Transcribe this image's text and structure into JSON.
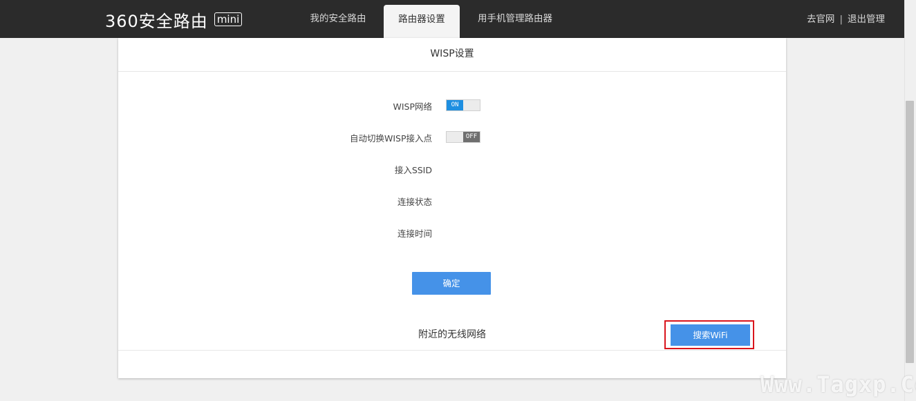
{
  "header": {
    "logo_text": "360安全路由",
    "logo_badge": "mini",
    "tabs": [
      {
        "label": "我的安全路由"
      },
      {
        "label": "路由器设置",
        "active": true
      },
      {
        "label": "用手机管理路由器"
      }
    ],
    "links": {
      "official_site": "去官网",
      "separator": "|",
      "logout": "退出管理"
    }
  },
  "wisp": {
    "title": "WISP设置",
    "rows": [
      {
        "label": "WISP网络",
        "toggle": "ON"
      },
      {
        "label": "自动切换WISP接入点",
        "toggle": "OFF"
      },
      {
        "label": "接入SSID"
      },
      {
        "label": "连接状态"
      },
      {
        "label": "连接时间"
      }
    ],
    "confirm_label": "确定"
  },
  "nearby": {
    "title": "附近的无线网络",
    "search_label": "搜索WiFi"
  },
  "watermark": "Www.Tagxp.Com",
  "colors": {
    "topbar": "#2b2b2b",
    "primary_button": "#4592e8",
    "toggle_on": "#1e8fe1",
    "toggle_off": "#6f6f6f",
    "highlight": "#d9141c"
  }
}
